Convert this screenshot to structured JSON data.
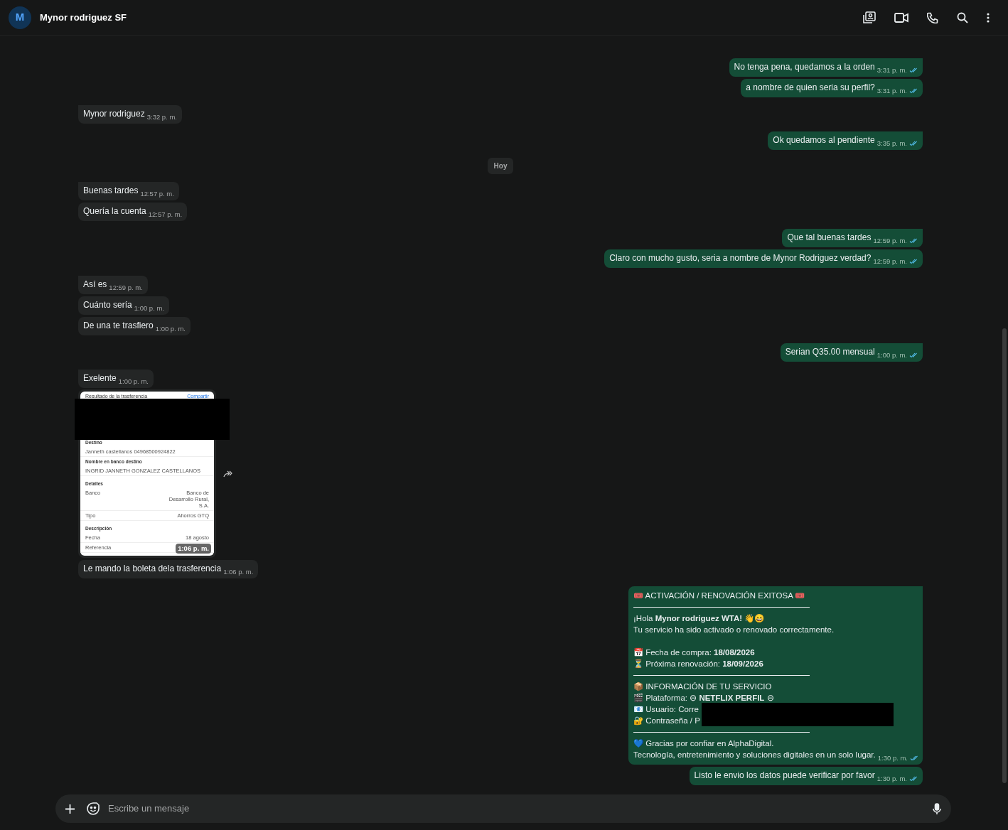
{
  "header": {
    "avatar_letter": "M",
    "title": "Mynor rodriguez SF"
  },
  "messages": [
    {
      "kind": "text",
      "outgoing": true,
      "tail": true,
      "text": "No tenga pena, quedamos a la orden",
      "time": "3:31 p. m.",
      "read": true
    },
    {
      "kind": "text",
      "outgoing": true,
      "tail": false,
      "text": "a nombre de quien seria su perfil?",
      "time": "3:31 p. m.",
      "read": true
    },
    {
      "kind": "text",
      "outgoing": false,
      "tail": true,
      "text": "Mynor rodriguez",
      "time": "3:32 p. m."
    },
    {
      "kind": "text",
      "outgoing": true,
      "tail": true,
      "text": "Ok quedamos al pendiente",
      "time": "3:35 p. m.",
      "read": true
    },
    {
      "kind": "day",
      "text": "Hoy"
    },
    {
      "kind": "text",
      "outgoing": false,
      "tail": true,
      "text": "Buenas tardes",
      "time": "12:57 p. m."
    },
    {
      "kind": "text",
      "outgoing": false,
      "tail": false,
      "text": "Quería la cuenta",
      "time": "12:57 p. m."
    },
    {
      "kind": "text",
      "outgoing": true,
      "tail": true,
      "text": "Que tal buenas tardes",
      "time": "12:59 p. m.",
      "read": true
    },
    {
      "kind": "text",
      "outgoing": true,
      "tail": false,
      "text": "Claro con mucho gusto, seria a nombre de Mynor Rodriguez verdad?",
      "time": "12:59 p. m.",
      "read": true
    },
    {
      "kind": "text",
      "outgoing": false,
      "tail": true,
      "text": "Así es",
      "time": "12:59 p. m."
    },
    {
      "kind": "text",
      "outgoing": false,
      "tail": false,
      "text": "Cuánto sería",
      "time": "1:00 p. m."
    },
    {
      "kind": "text",
      "outgoing": false,
      "tail": false,
      "text": "De una te trasfiero",
      "time": "1:00 p. m."
    },
    {
      "kind": "text",
      "outgoing": true,
      "tail": true,
      "text": "Serian Q35.00 mensual",
      "time": "1:00 p. m.",
      "read": true
    },
    {
      "kind": "text",
      "outgoing": false,
      "tail": true,
      "text": "Exelente",
      "time": "1:00 p. m."
    },
    {
      "kind": "image",
      "outgoing": false,
      "tail": false,
      "time": "1:06 p. m.",
      "receipt": {
        "title": "Resultado de la trasferencia",
        "action": "Compartir",
        "rows": [
          {
            "kind": "stacked",
            "label": "Destino",
            "value": "Janneth castellanos 04968500924822"
          },
          {
            "kind": "stacked",
            "label": "Nombre en banco destino",
            "value": "INGRID JANNETH GONZALEZ CASTELLANOS"
          },
          {
            "kind": "heading",
            "label": "Detalles"
          },
          {
            "kind": "pair",
            "label": "Banco",
            "value": "Banco de Desarrollo Rural, S.A."
          },
          {
            "kind": "pair",
            "label": "Tipo",
            "value": "Ahorros GTQ"
          },
          {
            "kind": "heading",
            "label": "Descripción"
          },
          {
            "kind": "pair",
            "label": "Fecha",
            "value": "18 agosto"
          },
          {
            "kind": "pair",
            "label": "Referencia"
          }
        ]
      }
    },
    {
      "kind": "text",
      "outgoing": false,
      "tail": false,
      "text": "Le mando la boleta dela trasferencia",
      "time": "1:06 p. m."
    },
    {
      "kind": "card",
      "outgoing": true,
      "tail": true,
      "time": "1:30 p. m.",
      "read": true,
      "lines": [
        {
          "kind": "text",
          "text": "🎟️ ACTIVACIÓN / RENOVACIÓN EXITOSA 🎟️"
        },
        {
          "kind": "divider"
        },
        {
          "kind": "text",
          "text": "¡Hola **Mynor rodriguez WTA!** 👋😄"
        },
        {
          "kind": "text",
          "text": "Tu servicio ha sido activado o renovado correctamente."
        },
        {
          "kind": "blank"
        },
        {
          "kind": "text",
          "text": "📅 Fecha de compra: **18/08/2026**"
        },
        {
          "kind": "text",
          "text": "⏳ Próxima renovación: **18/09/2026**"
        },
        {
          "kind": "divider"
        },
        {
          "kind": "text",
          "text": "📦 INFORMACIÓN DE TU SERVICIO"
        },
        {
          "kind": "text",
          "text": "🎬 Plataforma: ⊖ **NETFLIX PERFIL** ⊖"
        },
        {
          "kind": "redacted",
          "text": "📧 Usuario: Corre"
        },
        {
          "kind": "redacted",
          "text": "🔐 Contraseña / P"
        },
        {
          "kind": "divider"
        },
        {
          "kind": "text",
          "text": "💙 Gracias por confiar en AlphaDigital."
        },
        {
          "kind": "text",
          "text": "Tecnología, entretenimiento y soluciones digitales en un solo lugar."
        }
      ]
    },
    {
      "kind": "text",
      "outgoing": true,
      "tail": false,
      "text": "Listo le envio los datos puede verificar por favor",
      "time": "1:30 p. m.",
      "read": true
    }
  ],
  "composer": {
    "placeholder": "Escribe un mensaje"
  }
}
